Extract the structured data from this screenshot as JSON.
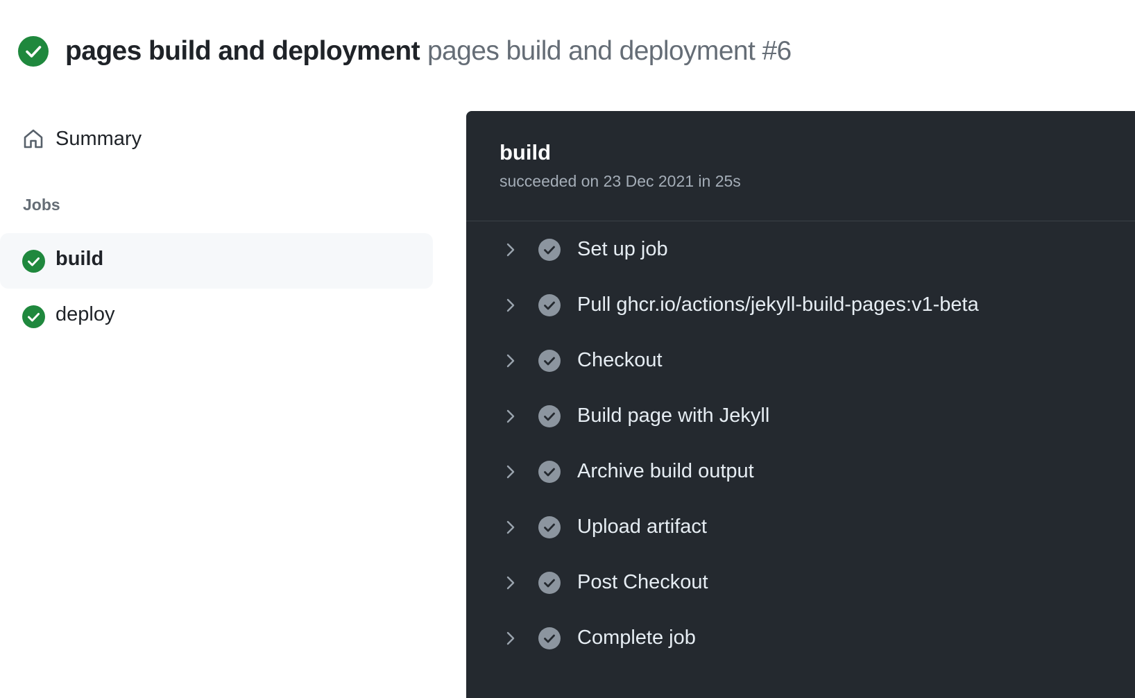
{
  "colors": {
    "success": "#1f883d",
    "panel_bg": "#24292f",
    "step_check": "#8c959f",
    "muted_text": "#656d76"
  },
  "header": {
    "status_icon": "check-circle-fill-icon",
    "title": "pages build and deployment",
    "subtitle": "pages build and deployment #6"
  },
  "sidebar": {
    "summary": {
      "icon": "home-icon",
      "label": "Summary"
    },
    "jobs_heading": "Jobs",
    "jobs": [
      {
        "label": "build",
        "status": "success",
        "selected": true
      },
      {
        "label": "deploy",
        "status": "success",
        "selected": false
      }
    ]
  },
  "log": {
    "job_title": "build",
    "job_meta": "succeeded on 23 Dec 2021 in 25s",
    "steps": [
      {
        "label": "Set up job",
        "status": "success"
      },
      {
        "label": "Pull ghcr.io/actions/jekyll-build-pages:v1-beta",
        "status": "success"
      },
      {
        "label": "Checkout",
        "status": "success"
      },
      {
        "label": "Build page with Jekyll",
        "status": "success"
      },
      {
        "label": "Archive build output",
        "status": "success"
      },
      {
        "label": "Upload artifact",
        "status": "success"
      },
      {
        "label": "Post Checkout",
        "status": "success"
      },
      {
        "label": "Complete job",
        "status": "success"
      }
    ]
  }
}
